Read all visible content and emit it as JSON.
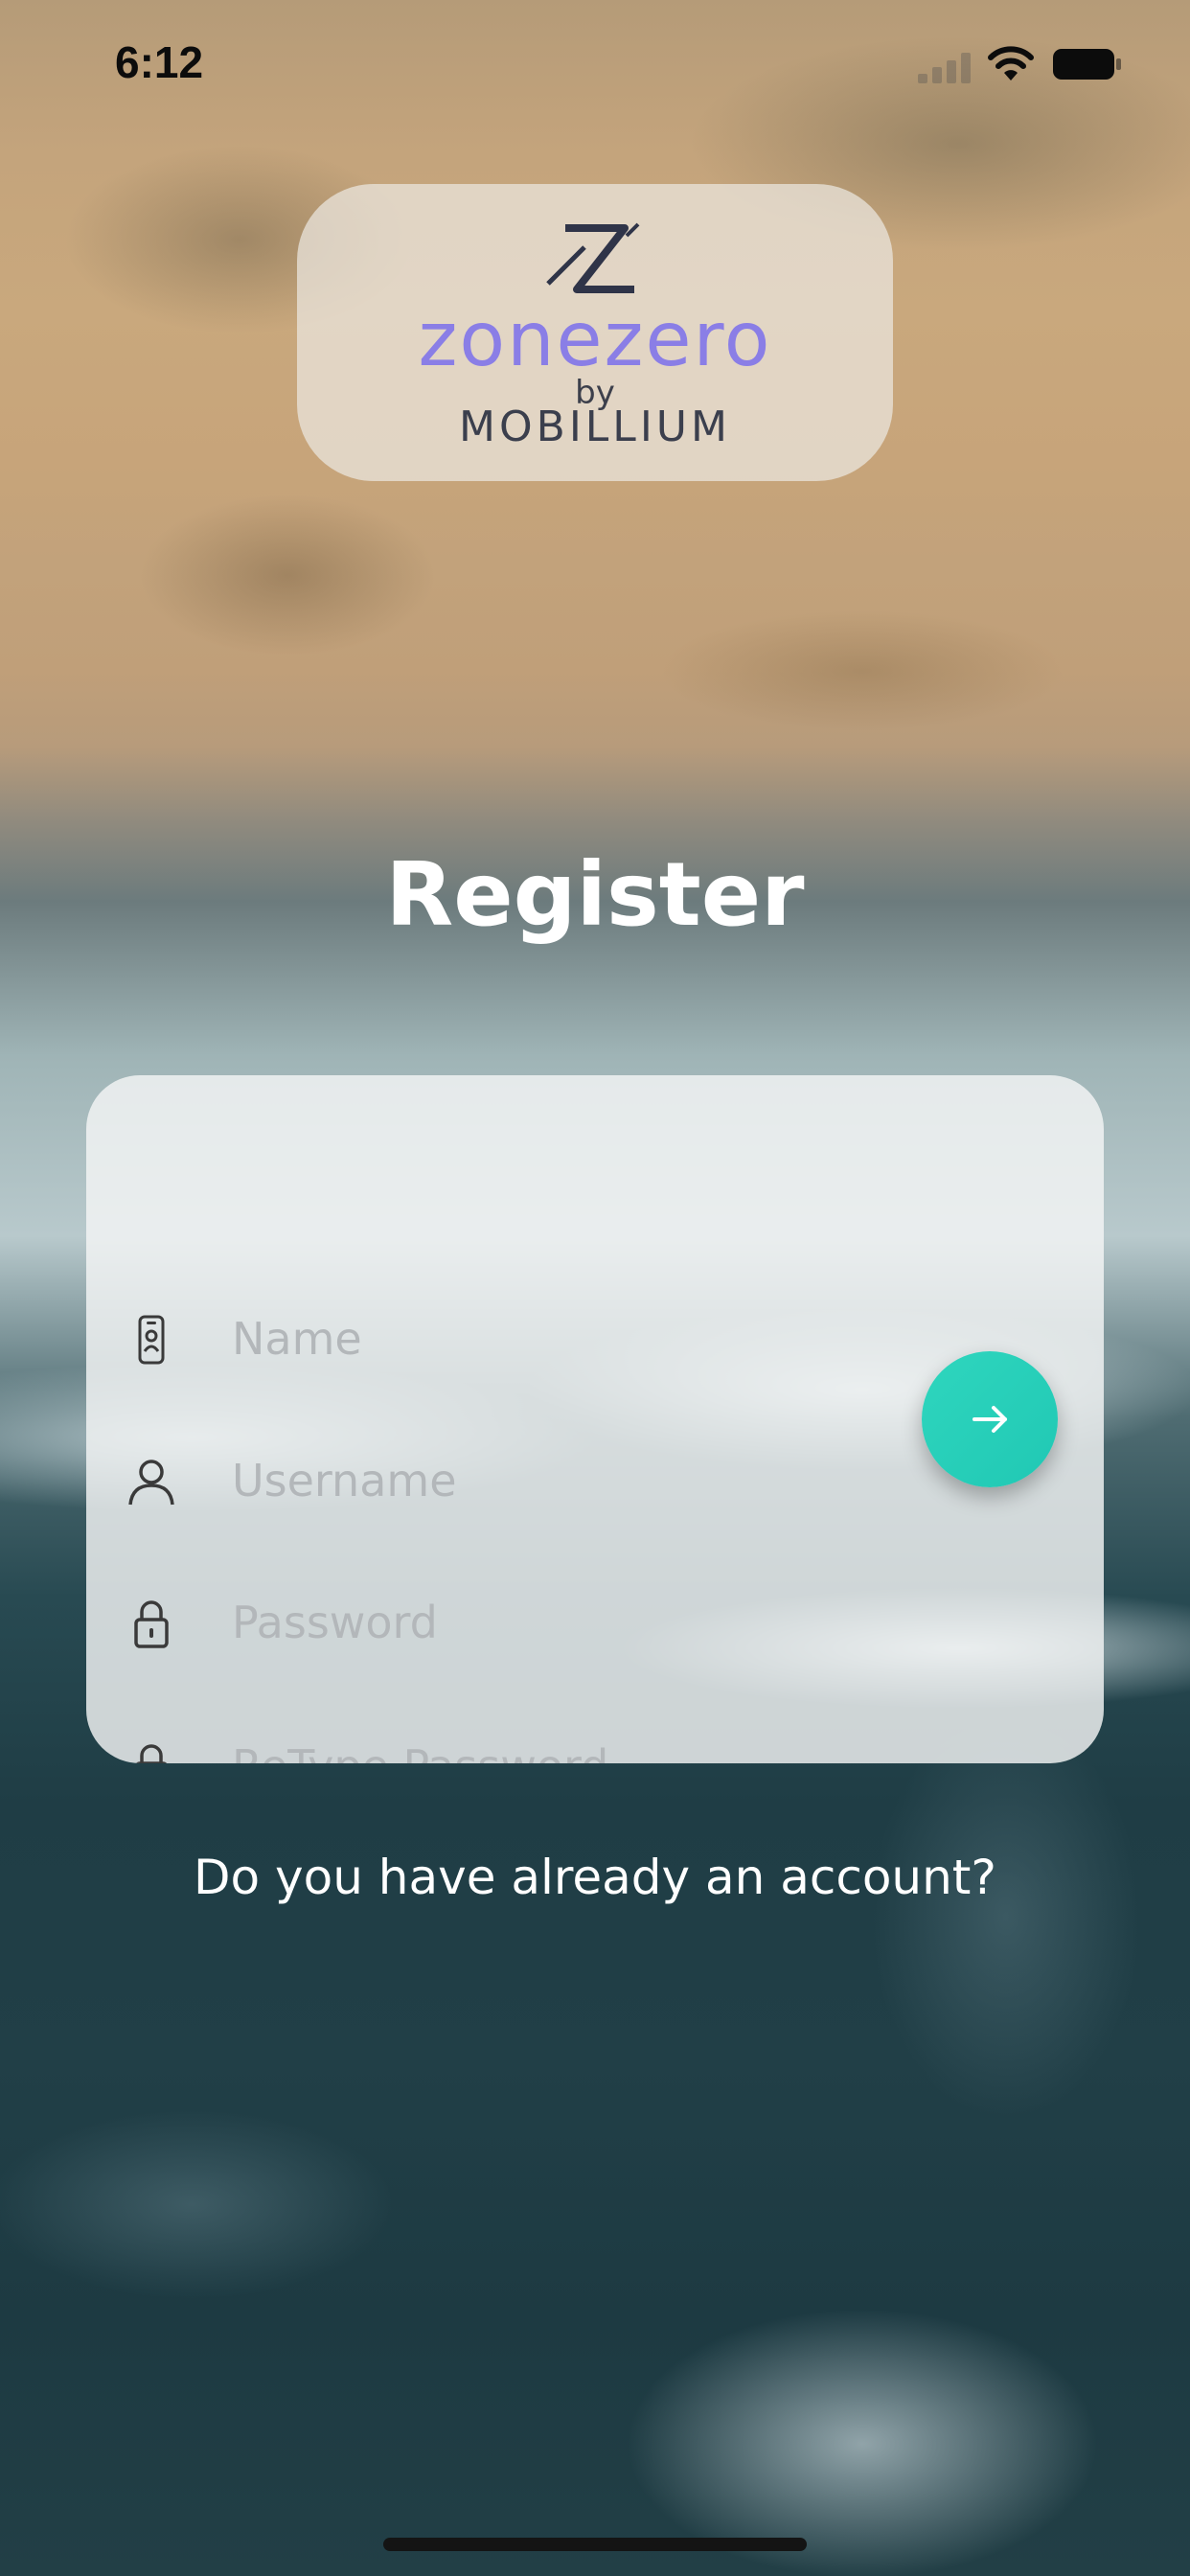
{
  "status_bar": {
    "time": "6:12",
    "icons": [
      "cellular-signal-icon",
      "wifi-icon",
      "battery-icon"
    ]
  },
  "logo": {
    "wordmark": "zonezero",
    "by": "by",
    "company": "MOBILLIUM"
  },
  "title": "Register",
  "form": {
    "fields": [
      {
        "icon": "id-badge-icon",
        "placeholder": "Name",
        "value": ""
      },
      {
        "icon": "person-icon",
        "placeholder": "Username",
        "value": ""
      },
      {
        "icon": "lock-icon",
        "placeholder": "Password",
        "value": ""
      },
      {
        "icon": "lock-icon",
        "placeholder": "ReType Password",
        "value": ""
      }
    ],
    "submit_icon": "arrow-right-icon"
  },
  "account_prompt": "Do you have already an account?",
  "colors": {
    "accent": "#26cfb9",
    "logo_wordmark": "#8a7ee6",
    "placeholder": "#b3b7ba",
    "card_bg": "#f4f5f5",
    "text_light": "#ffffff"
  }
}
